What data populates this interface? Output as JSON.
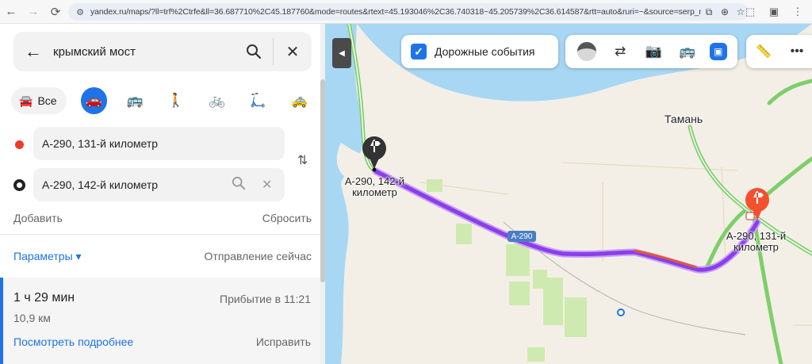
{
  "browser": {
    "url": "yandex.ru/maps/?ll=trf%2Ctrfe&ll=36.687710%2C45.187760&mode=routes&rtext=45.193046%2C36.740318~45.205739%2C36.614587&rtt=auto&ruri=~&source=serp_na..."
  },
  "search": {
    "query": "крымский мост"
  },
  "modes": {
    "all_label": "Все"
  },
  "waypoints": {
    "from": "А-290, 131-й километр",
    "to": "А-290, 142-й километр"
  },
  "actions": {
    "add": "Добавить",
    "reset": "Сбросить"
  },
  "options": {
    "params": "Параметры ▾",
    "departure": "Отправление сейчас"
  },
  "route": {
    "duration": "1 ч 29 мин",
    "arrival": "Прибытие в 11:21",
    "distance": "10,9 км",
    "details": "Посмотреть подробнее",
    "fix": "Исправить"
  },
  "map": {
    "traffic_label": "Дорожные события",
    "town": "Тамань",
    "road_badge": "А-290",
    "start_label_1": "А-290, 142-й",
    "start_label_2": "километр",
    "end_label_1": "А-290, 131-й",
    "end_label_2": "километр"
  },
  "colors": {
    "accent": "#1e73e8",
    "route": "#8a3ee8",
    "marker": "#f4502e"
  }
}
